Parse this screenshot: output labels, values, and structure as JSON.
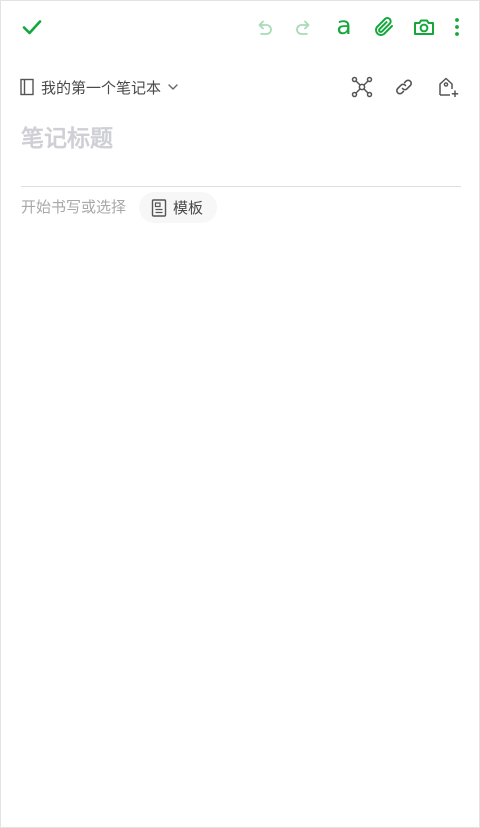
{
  "colors": {
    "accent": "#14a83b",
    "accent_disabled": "#a7dcb6",
    "icon_gray": "#555555",
    "placeholder": "#cfcfd6",
    "hint_text": "#a8a8a8"
  },
  "toolbar": {
    "done_icon": "checkmark-icon",
    "undo_icon": "undo-icon",
    "redo_icon": "redo-icon",
    "format_glyph": "a",
    "attach_icon": "paperclip-icon",
    "camera_icon": "camera-icon",
    "more_icon": "more-vertical-icon"
  },
  "notebook": {
    "name": "我的第一个笔记本",
    "icon": "notebook-icon",
    "dropdown_icon": "chevron-down-icon"
  },
  "actions": {
    "mindmap_icon": "mindmap-icon",
    "link_icon": "link-icon",
    "tag_icon": "add-tag-icon"
  },
  "note": {
    "title_placeholder": "笔记标题",
    "title_value": "",
    "body_hint": "开始书写或选择",
    "template_label": "模板",
    "template_icon": "template-icon"
  }
}
